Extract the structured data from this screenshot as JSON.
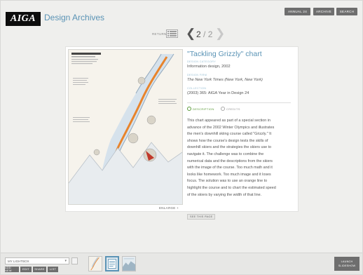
{
  "header": {
    "logo_text": "AIGA",
    "site_title": "Design Archives",
    "buttons": {
      "annual": "ANNUAL 24",
      "archive": "ARCHIVE",
      "search": "SEARCH"
    }
  },
  "nav": {
    "return_label": "RETURN",
    "current_page": "2",
    "page_separator": "/",
    "total_pages": "2"
  },
  "item": {
    "title": "\"Tackling Grizzly\" chart",
    "image_label": "ENLARGE +",
    "meta": [
      {
        "label": "DESIGN CATEGORY",
        "value": "Information design, 2002"
      },
      {
        "label": "DESIGN FIRM",
        "value": "The New York Times (New York, New York)"
      },
      {
        "label": "COLLECTION",
        "value": "(2003) 365: AIGA Year in Design 24"
      }
    ],
    "tabs": {
      "description": "DESCRIPTION",
      "credits": "CREDITS"
    },
    "description_lines": [
      "This chart appeared as part of a special section in",
      "advance of the 2002 Winter Olympics and illustrates",
      "the men's downhill skiing course called \"Grizzly.\" It",
      "shows how the course's design tests the skills of",
      "downhill skiers and the strategies the skiers use to",
      "navigate it. The challenge was to combine the",
      "numerical data and the descriptions from the skiers",
      "with the image of the course. Too much math and it",
      "looks like homework. Too much image and it loses",
      "focus. The solution was to use an orange line to",
      "highlight the course and to chart the estimated speed",
      "of the skiers by varying the width of that line."
    ],
    "see_page_label": "SEE THIS PAGE"
  },
  "bottom": {
    "collection_select": "MY LIGHTBOX",
    "buttons": {
      "add": "ADD NEW",
      "edit": "EDIT",
      "share": "SHARE",
      "list": "LIST"
    },
    "slideshow_line1": "LAUNCH",
    "slideshow_line2": "SLIDESHOW"
  },
  "colors": {
    "accent_blue": "#5a93b5",
    "accent_green": "#5b9a39",
    "button_gray": "#6e6e6e",
    "background": "#efefed"
  },
  "icons": [
    "list-view-icon",
    "chevron-left-icon",
    "chevron-right-icon",
    "circle-bullet-icon",
    "dropdown-arrow-icon"
  ]
}
